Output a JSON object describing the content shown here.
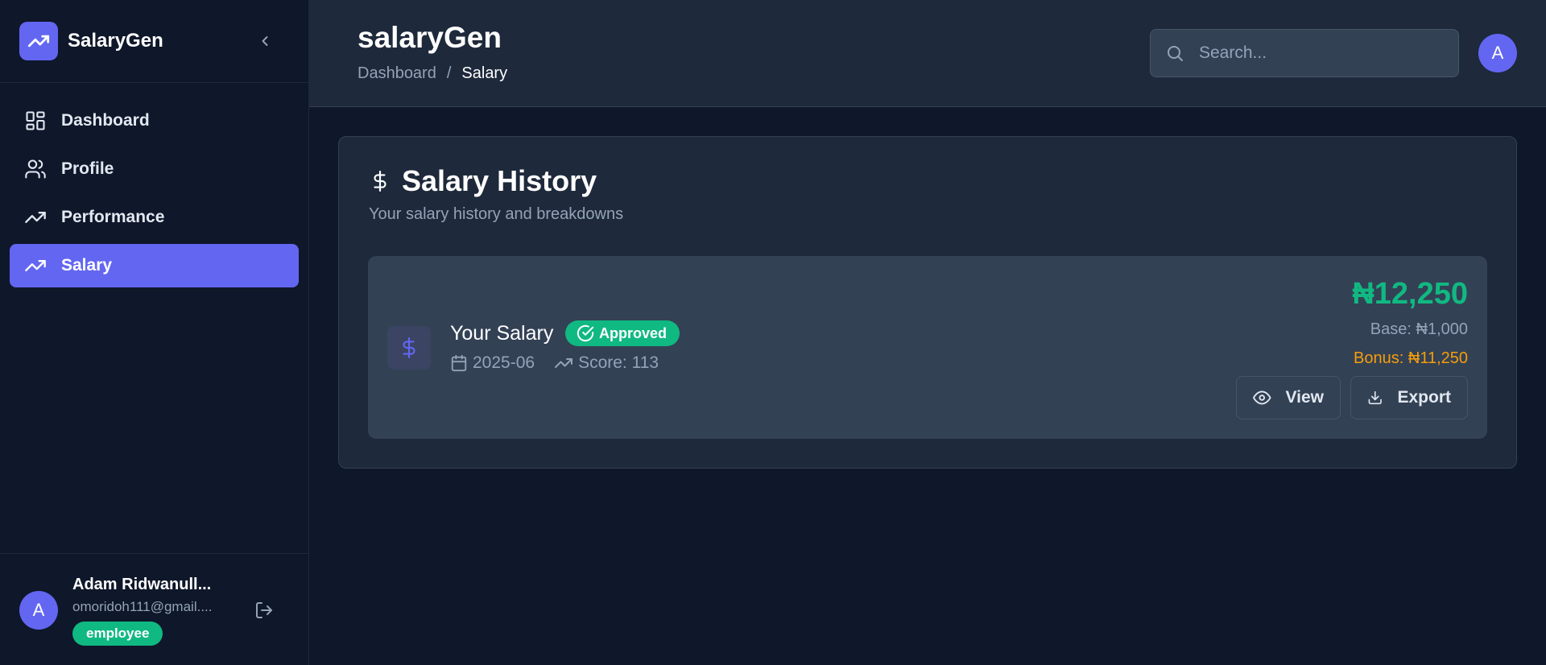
{
  "sidebar": {
    "brand": "SalaryGen",
    "items": [
      {
        "label": "Dashboard",
        "icon": "dashboard-icon",
        "active": false
      },
      {
        "label": "Profile",
        "icon": "users-icon",
        "active": false
      },
      {
        "label": "Performance",
        "icon": "trending-up-icon",
        "active": false
      },
      {
        "label": "Salary",
        "icon": "trending-up-icon",
        "active": true
      }
    ],
    "user": {
      "initial": "A",
      "name": "Adam Ridwanull...",
      "email": "omoridoh111@gmail....",
      "role": "employee"
    }
  },
  "header": {
    "title": "salaryGen",
    "breadcrumb": {
      "root": "Dashboard",
      "separator": "/",
      "current": "Salary"
    },
    "search_placeholder": "Search...",
    "avatar_initial": "A"
  },
  "card": {
    "title": "Salary History",
    "subtitle": "Your salary history and breakdowns",
    "entry": {
      "title": "Your Salary",
      "status": "Approved",
      "period": "2025-06",
      "score": "Score: 113",
      "total": "₦12,250",
      "base": "Base: ₦1,000",
      "bonus": "Bonus: ₦11,250",
      "view_label": "View",
      "export_label": "Export"
    }
  },
  "colors": {
    "background": "#0f172a",
    "panel": "#1e293b",
    "accent": "#6366f1",
    "success": "#10b981",
    "bonus": "#f59e0b"
  }
}
